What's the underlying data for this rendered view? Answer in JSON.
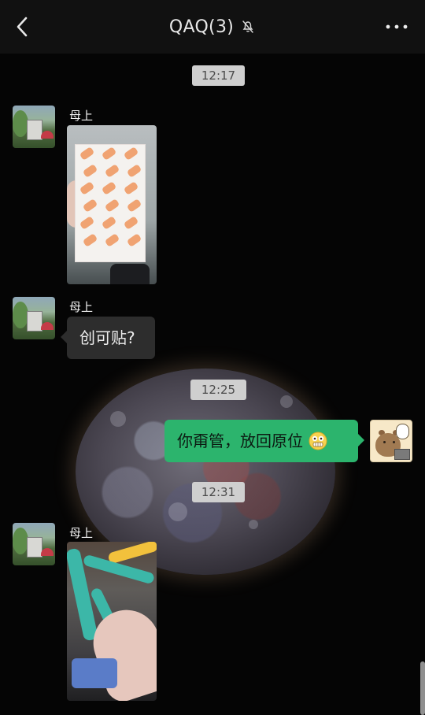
{
  "header": {
    "title": "QAQ(3)",
    "back_icon": "chevron-left-icon",
    "mute_icon": "bell-off-icon",
    "more_icon": "ellipsis-icon"
  },
  "timestamps": [
    {
      "label": "12:17"
    },
    {
      "label": "12:25"
    },
    {
      "label": "12:31"
    }
  ],
  "messages": [
    {
      "sender": "母上",
      "type": "image",
      "avatar": "mom-avatar"
    },
    {
      "sender": "母上",
      "type": "text",
      "text": "创可贴?"
    },
    {
      "sender": "me",
      "type": "text",
      "text": "你甭管，放回原位",
      "avatar": "capybara-avatar",
      "emoji": "grimacing-face-icon"
    },
    {
      "sender": "母上",
      "type": "image",
      "avatar": "mom-avatar"
    }
  ],
  "colors": {
    "background": "#050505",
    "header": "#111111",
    "incoming_bubble": "#2d2d2d",
    "outgoing_bubble": "#2cb46d",
    "time_badge": "#cfcfcf"
  }
}
